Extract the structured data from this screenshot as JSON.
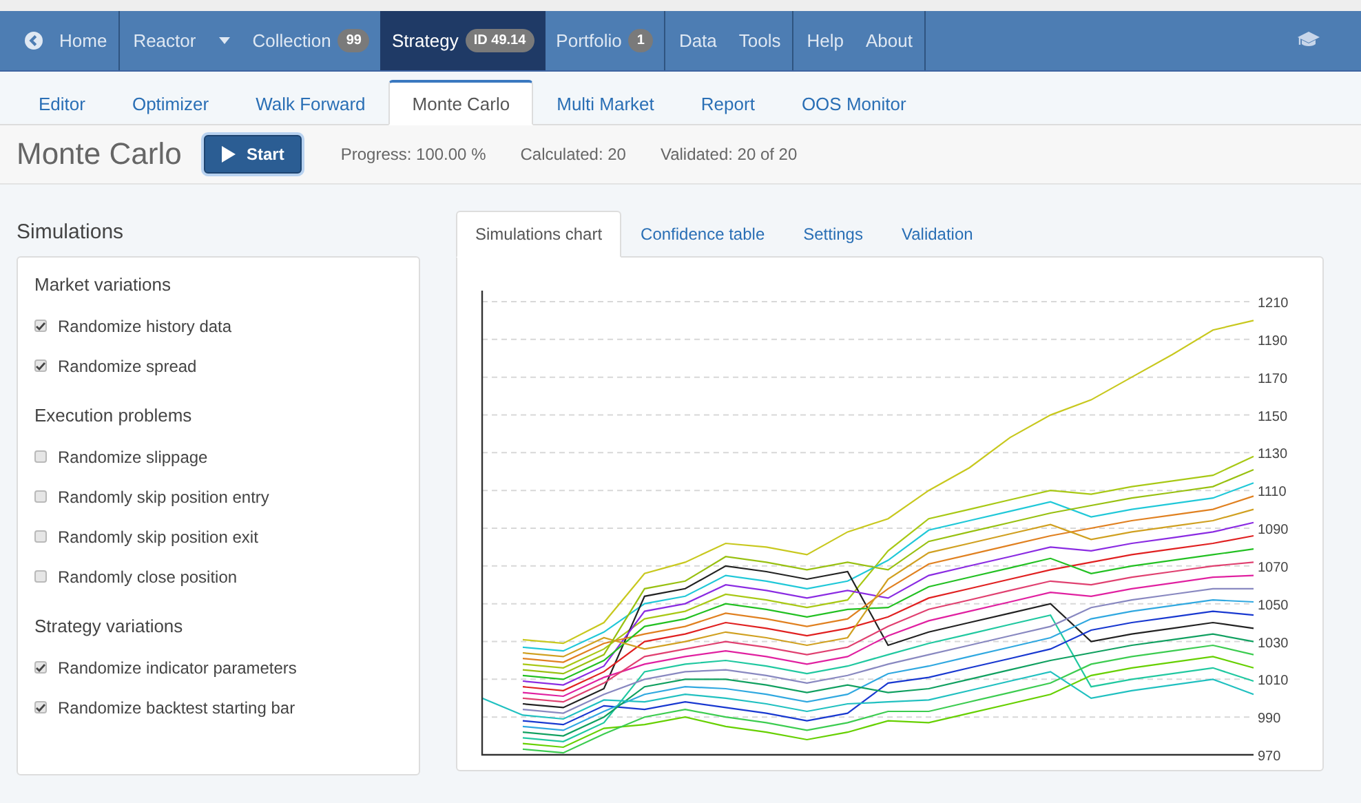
{
  "nav": {
    "groups": [
      [
        {
          "label": "Home",
          "kind": "back",
          "selected": false
        }
      ],
      [
        {
          "label": "Reactor",
          "kind": "dropdown",
          "selected": false
        },
        {
          "label": "Collection",
          "badge": "99",
          "selected": false
        },
        {
          "label": "Strategy",
          "badge": "ID 49.14",
          "selected": true
        },
        {
          "label": "Portfolio",
          "badge": "1",
          "selected": false
        }
      ],
      [
        {
          "label": "Data",
          "selected": false
        },
        {
          "label": "Tools",
          "selected": false
        }
      ],
      [
        {
          "label": "Help",
          "selected": false
        },
        {
          "label": "About",
          "selected": false
        }
      ]
    ]
  },
  "subtabs": [
    {
      "label": "Editor",
      "selected": false
    },
    {
      "label": "Optimizer",
      "selected": false
    },
    {
      "label": "Walk Forward",
      "selected": false
    },
    {
      "label": "Monte Carlo",
      "selected": true
    },
    {
      "label": "Multi Market",
      "selected": false
    },
    {
      "label": "Report",
      "selected": false
    },
    {
      "label": "OOS Monitor",
      "selected": false
    }
  ],
  "header": {
    "title": "Monte Carlo",
    "button": "Start",
    "stats": [
      "Progress: 100.00 %",
      "Calculated: 20",
      "Validated: 20 of 20"
    ]
  },
  "simulations": {
    "title": "Simulations",
    "sections": [
      {
        "title": "Market variations",
        "options": [
          {
            "label": "Randomize history data",
            "checked": true
          },
          {
            "label": "Randomize spread",
            "checked": true
          }
        ]
      },
      {
        "title": "Execution problems",
        "options": [
          {
            "label": "Randomize slippage",
            "checked": false
          },
          {
            "label": "Randomly skip position entry",
            "checked": false
          },
          {
            "label": "Randomly skip position exit",
            "checked": false
          },
          {
            "label": "Randomly close position",
            "checked": false
          }
        ]
      },
      {
        "title": "Strategy variations",
        "options": [
          {
            "label": "Randomize indicator parameters",
            "checked": true
          },
          {
            "label": "Randomize backtest starting bar",
            "checked": true
          }
        ]
      }
    ]
  },
  "chart_tabs": [
    {
      "label": "Simulations chart",
      "selected": true
    },
    {
      "label": "Confidence table",
      "selected": false
    },
    {
      "label": "Settings",
      "selected": false
    },
    {
      "label": "Validation",
      "selected": false
    }
  ],
  "chart_data": {
    "type": "line",
    "grid": true,
    "ylim": [
      970,
      1210
    ],
    "yticks": [
      970,
      990,
      1010,
      1030,
      1050,
      1070,
      1090,
      1110,
      1130,
      1150,
      1170,
      1190,
      1210
    ],
    "series": [
      {
        "color": "#c8c81e",
        "values": [
          null,
          1031,
          1029,
          1040,
          1066,
          1072,
          1082,
          1080,
          1076,
          1088,
          1095,
          1110,
          1122,
          1138,
          1150,
          1158,
          1170,
          1182,
          1195,
          1200
        ]
      },
      {
        "color": "#a8c814",
        "values": [
          null,
          1018,
          1016,
          1026,
          1042,
          1046,
          1055,
          1052,
          1048,
          1052,
          1078,
          1095,
          1100,
          1105,
          1110,
          1108,
          1112,
          1115,
          1118,
          1128
        ]
      },
      {
        "color": "#20c8d8",
        "values": [
          null,
          1027,
          1025,
          1035,
          1050,
          1054,
          1065,
          1062,
          1058,
          1062,
          1073,
          1089,
          1094,
          1099,
          1104,
          1096,
          1100,
          1103,
          1106,
          1114
        ]
      },
      {
        "color": "#222222",
        "values": [
          null,
          997,
          995,
          1005,
          1054,
          1058,
          1070,
          1067,
          1063,
          1067,
          1028,
          1035,
          1040,
          1045,
          1050,
          1030,
          1034,
          1037,
          1040,
          1037
        ]
      },
      {
        "color": "#8a2be2",
        "values": [
          null,
          1009,
          1007,
          1017,
          1046,
          1050,
          1060,
          1057,
          1053,
          1057,
          1053,
          1065,
          1070,
          1075,
          1080,
          1078,
          1082,
          1085,
          1088,
          1093
        ]
      },
      {
        "color": "#e02020",
        "values": [
          null,
          1006,
          1004,
          1014,
          1030,
          1034,
          1040,
          1037,
          1033,
          1037,
          1043,
          1053,
          1058,
          1063,
          1068,
          1072,
          1076,
          1079,
          1082,
          1086
        ]
      },
      {
        "color": "#e08020",
        "values": [
          null,
          1021,
          1019,
          1029,
          1034,
          1038,
          1045,
          1042,
          1038,
          1042,
          1058,
          1071,
          1076,
          1081,
          1086,
          1090,
          1094,
          1097,
          1100,
          1107
        ]
      },
      {
        "color": "#e020a0",
        "values": [
          null,
          1003,
          1001,
          1011,
          1018,
          1022,
          1025,
          1022,
          1018,
          1022,
          1033,
          1041,
          1046,
          1051,
          1056,
          1054,
          1058,
          1061,
          1064,
          1065
        ]
      },
      {
        "color": "#22c022",
        "values": [
          null,
          1012,
          1010,
          1020,
          1038,
          1042,
          1050,
          1047,
          1043,
          1047,
          1048,
          1059,
          1064,
          1069,
          1074,
          1066,
          1070,
          1073,
          1076,
          1079
        ]
      },
      {
        "color": "#20c8a0",
        "values": [
          null,
          979,
          977,
          987,
          1014,
          1018,
          1020,
          1017,
          1013,
          1017,
          1023,
          1029,
          1034,
          1039,
          1044,
          1006,
          1010,
          1013,
          1016,
          1009
        ]
      },
      {
        "color": "#1838d0",
        "values": [
          null,
          988,
          986,
          996,
          994,
          998,
          995,
          992,
          988,
          992,
          1008,
          1011,
          1016,
          1021,
          1026,
          1036,
          1040,
          1043,
          1046,
          1044
        ]
      },
      {
        "color": "#8888c0",
        "values": [
          null,
          994,
          992,
          1002,
          1010,
          1014,
          1015,
          1012,
          1008,
          1012,
          1018,
          1023,
          1028,
          1033,
          1038,
          1048,
          1052,
          1055,
          1058,
          1058
        ]
      },
      {
        "color": "#66d000",
        "values": [
          null,
          976,
          974,
          984,
          986,
          990,
          985,
          982,
          978,
          982,
          988,
          987,
          992,
          997,
          1002,
          1012,
          1016,
          1019,
          1022,
          1016
        ]
      },
      {
        "color": "#d0a020",
        "values": [
          null,
          1024,
          1022,
          1032,
          1026,
          1030,
          1035,
          1032,
          1028,
          1032,
          1063,
          1077,
          1082,
          1087,
          1092,
          1084,
          1088,
          1091,
          1094,
          1100
        ]
      },
      {
        "color": "#e04070",
        "values": [
          null,
          1000,
          998,
          1008,
          1022,
          1026,
          1030,
          1027,
          1023,
          1027,
          1038,
          1047,
          1052,
          1057,
          1062,
          1060,
          1064,
          1067,
          1070,
          1072
        ]
      },
      {
        "color": "#30a8e0",
        "values": [
          null,
          985,
          983,
          993,
          1002,
          1006,
          1005,
          1002,
          998,
          1002,
          1013,
          1017,
          1022,
          1027,
          1032,
          1042,
          1046,
          1049,
          1052,
          1051
        ]
      },
      {
        "color": "#98c010",
        "values": [
          null,
          1015,
          1013,
          1023,
          1058,
          1062,
          1075,
          1072,
          1068,
          1072,
          1068,
          1083,
          1088,
          1093,
          1098,
          1102,
          1106,
          1109,
          1112,
          1121
        ]
      },
      {
        "color": "#3ccc50",
        "values": [
          null,
          973,
          971,
          981,
          990,
          994,
          990,
          987,
          983,
          987,
          993,
          993,
          998,
          1003,
          1008,
          1018,
          1022,
          1025,
          1028,
          1023
        ]
      },
      {
        "color": "#10a060",
        "values": [
          null,
          982,
          980,
          990,
          1006,
          1010,
          1010,
          1007,
          1003,
          1007,
          1003,
          1005,
          1010,
          1015,
          1020,
          1024,
          1028,
          1031,
          1034,
          1030
        ]
      },
      {
        "color": "#20c0c0",
        "values": [
          1000,
          991,
          989,
          999,
          998,
          1002,
          1000,
          997,
          993,
          997,
          998,
          999,
          1004,
          1009,
          1014,
          1000,
          1004,
          1007,
          1010,
          1002
        ]
      }
    ]
  }
}
